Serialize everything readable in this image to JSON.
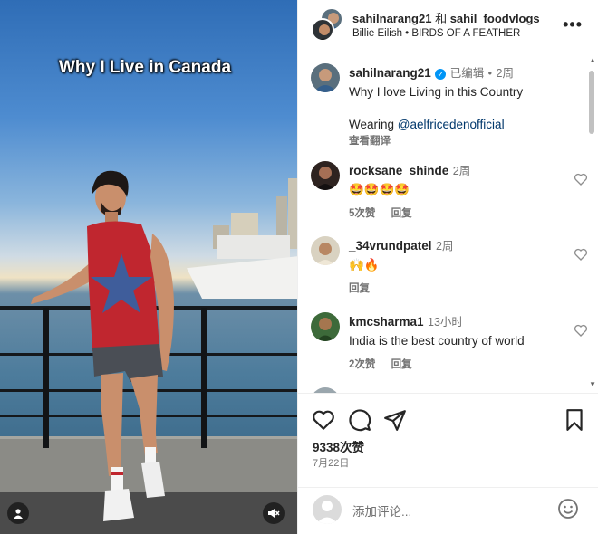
{
  "video": {
    "overlay_title": "Why I Live in Canada"
  },
  "header": {
    "user1": "sahilnarang21",
    "conj": "和",
    "user2": "sahil_foodvlogs",
    "artist": "Billie Eilish",
    "separator": "•",
    "song": "BIRDS OF A FEATHER"
  },
  "caption": {
    "username": "sahilnarang21",
    "edited": "已编辑",
    "dot": "•",
    "time": "2周",
    "text": "Why I love Living in this Country",
    "wearing": "Wearing",
    "mention": "@aelfricedenofficial",
    "translate": "查看翻译"
  },
  "comments": [
    {
      "username": "rocksane_shinde",
      "time": "2周",
      "text": "🤩🤩🤩🤩",
      "likes": "5次赞",
      "reply": "回复"
    },
    {
      "username": "_34vrundpatel",
      "time": "2周",
      "text": "🙌🔥",
      "likes": "",
      "reply": "回复"
    },
    {
      "username": "kmcsharma1",
      "time": "13小时",
      "text": "India is the best country of world",
      "likes": "2次赞",
      "reply": "回复"
    }
  ],
  "footer": {
    "like_count": "9338次赞",
    "date": "7月22日",
    "add_comment_placeholder": "添加评论..."
  },
  "colors": {
    "accent": "#0095f6",
    "link": "#00376b",
    "muted": "#737373"
  }
}
